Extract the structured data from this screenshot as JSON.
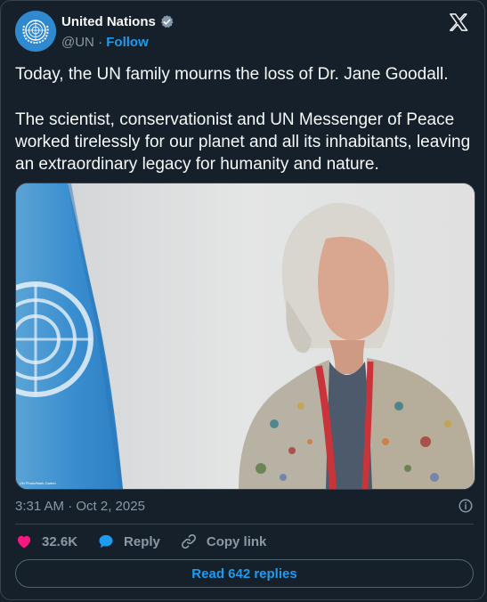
{
  "account": {
    "name": "United Nations",
    "handle": "@UN",
    "separator": "·",
    "follow_label": "Follow"
  },
  "post": {
    "paragraphs": [
      "Today, the UN family mourns the loss of Dr. Jane Goodall.",
      "The scientist, conservationist and UN Messenger of Peace worked tirelessly for our planet and all its inhabitants, leaving an extraordinary legacy for humanity and nature."
    ],
    "photo_credit": "UN Photo/Mark Garten",
    "timestamp": "3:31 AM · Oct 2, 2025"
  },
  "actions": {
    "like_count": "32.6K",
    "reply_label": "Reply",
    "copy_link_label": "Copy link"
  },
  "footer": {
    "read_replies_label": "Read 642 replies"
  },
  "colors": {
    "background": "#15202b",
    "accent": "#1d9bf0",
    "like": "#f91880",
    "muted": "#8b98a5"
  },
  "icons": [
    "un-emblem-avatar",
    "verified-badge-icon",
    "x-logo-icon",
    "info-icon",
    "heart-icon",
    "reply-bubble-icon",
    "link-icon"
  ]
}
